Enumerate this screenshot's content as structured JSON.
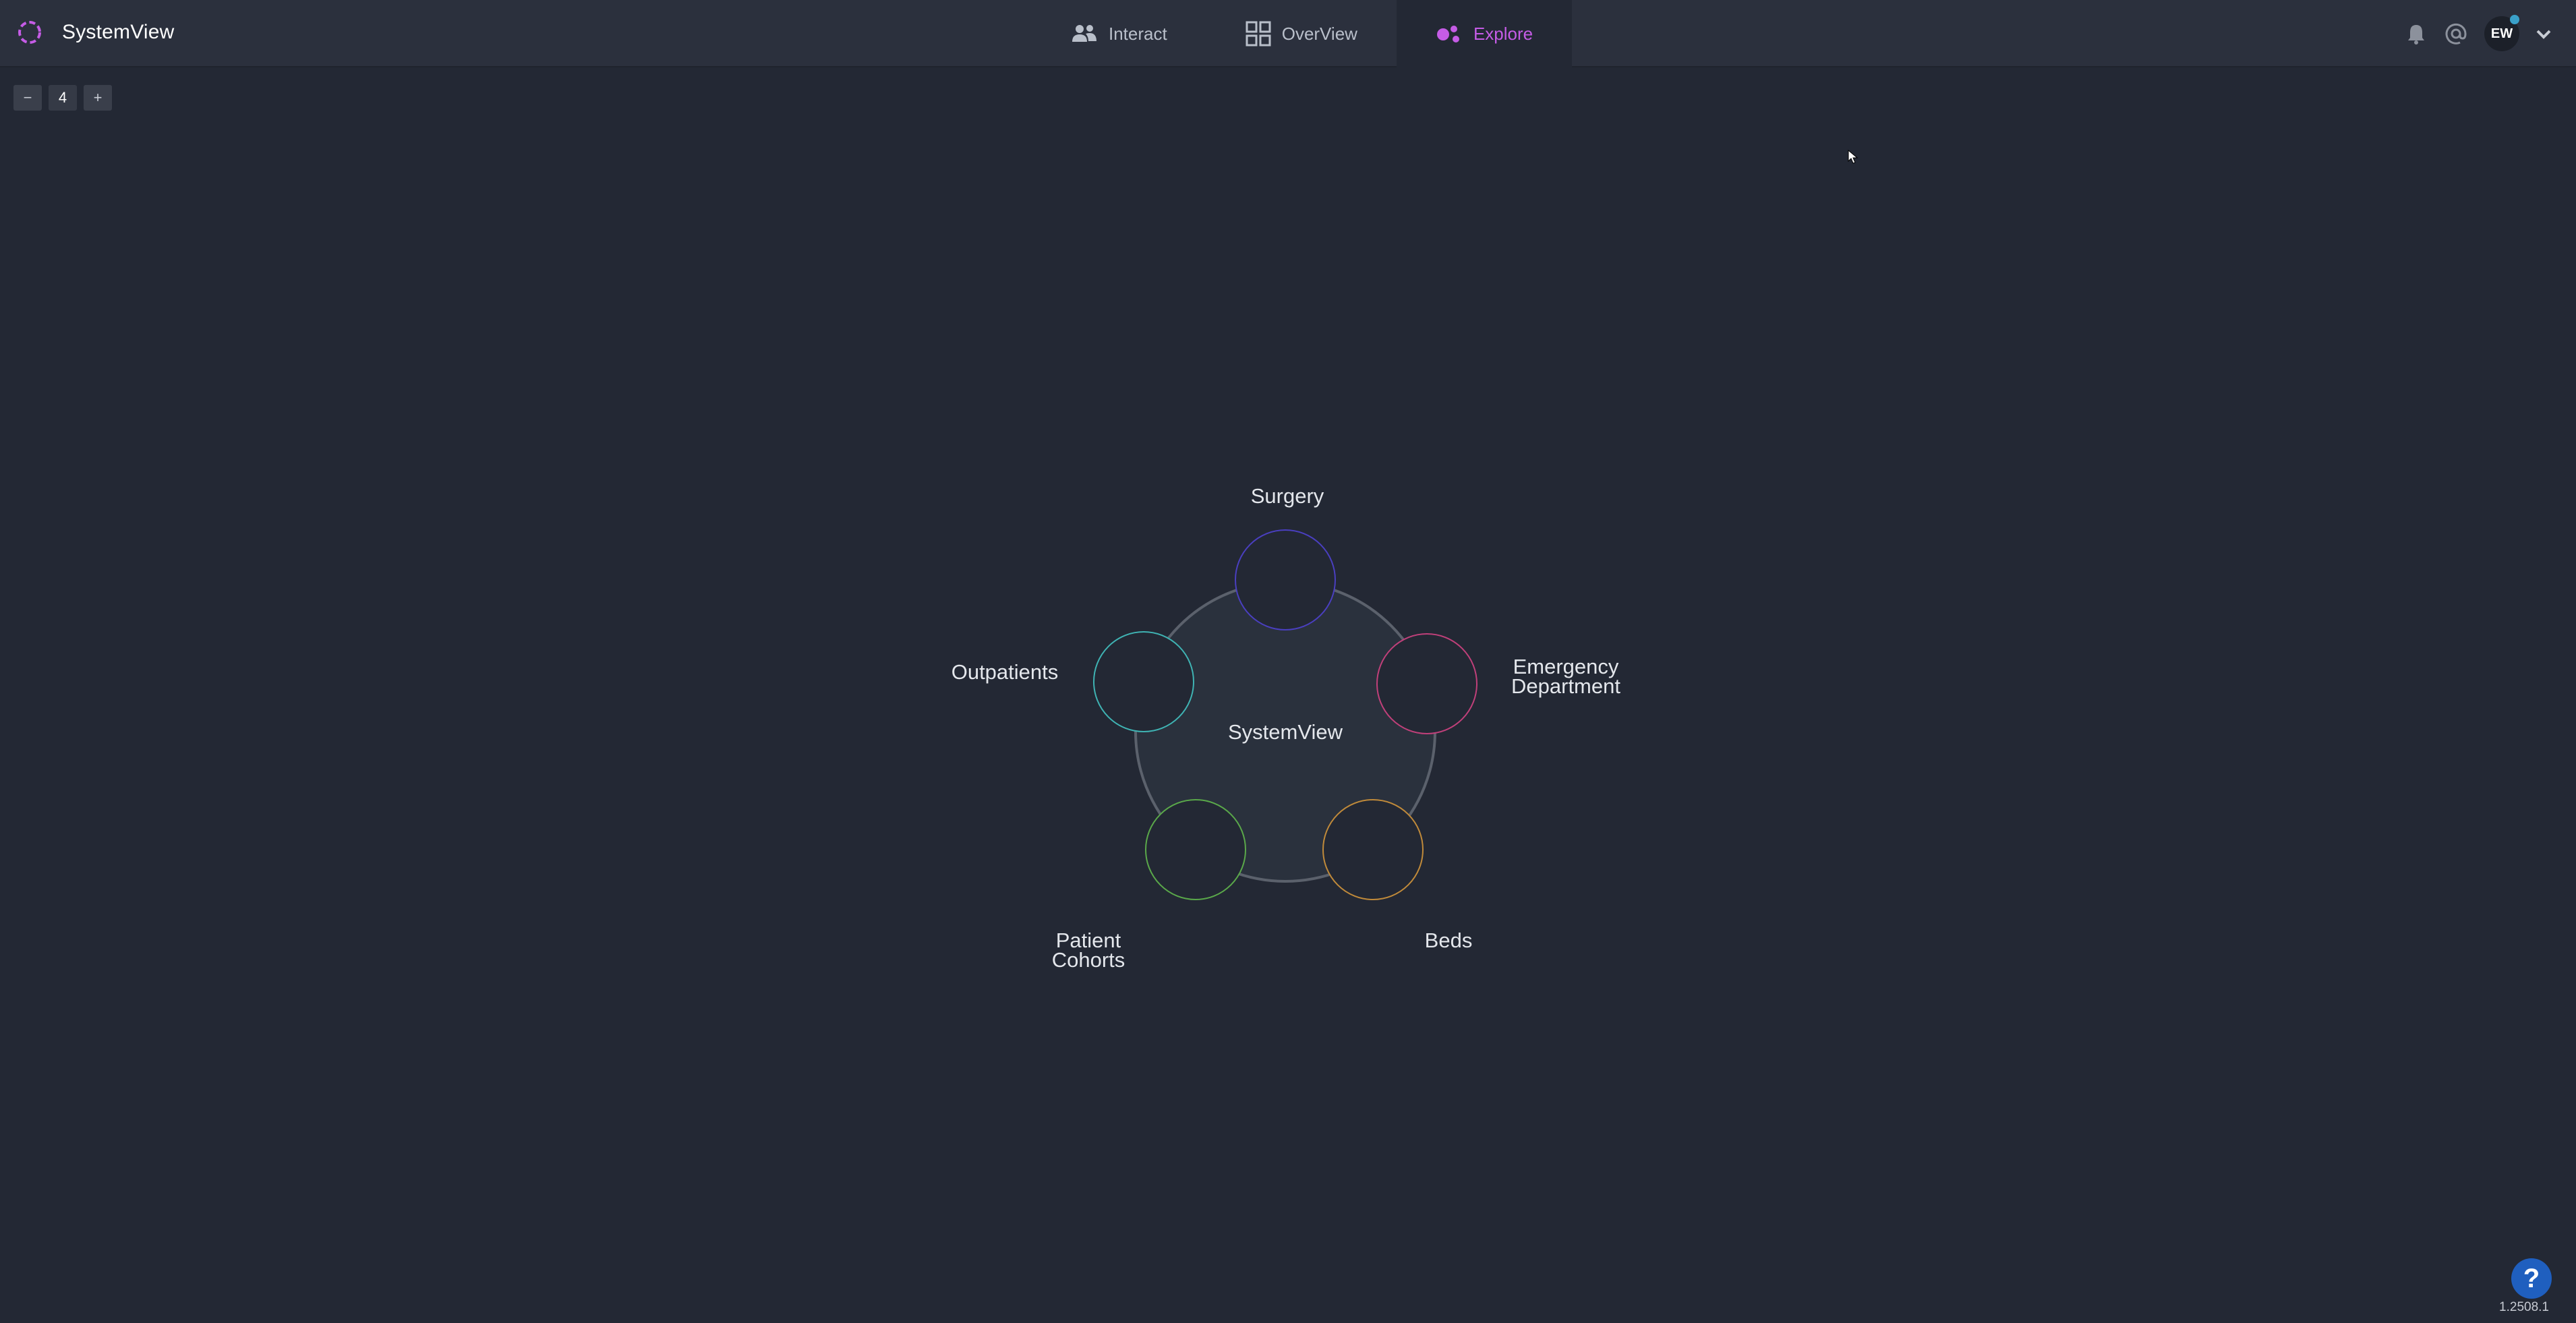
{
  "app": {
    "title": "SystemView",
    "accent": "#c55ce6"
  },
  "nav": {
    "items": [
      {
        "label": "Interact",
        "icon": "users-icon",
        "active": false
      },
      {
        "label": "OverView",
        "icon": "grid-icon",
        "active": false
      },
      {
        "label": "Explore",
        "icon": "explore-icon",
        "active": true
      }
    ]
  },
  "header": {
    "user_initials": "EW",
    "icons": [
      "bell-icon",
      "at-icon",
      "chevron-down-icon"
    ]
  },
  "zoom": {
    "minus_label": "−",
    "level": "4",
    "plus_label": "+"
  },
  "graph": {
    "center_label": "SystemView",
    "nodes": [
      {
        "name": "surgery",
        "line1": "Surgery",
        "line2": "",
        "color": "#4a3fc0"
      },
      {
        "name": "emergency-department",
        "line1": "Emergency",
        "line2": "Department",
        "color": "#c0407a"
      },
      {
        "name": "beds",
        "line1": "Beds",
        "line2": "",
        "color": "#c08a3a"
      },
      {
        "name": "patient-cohorts",
        "line1": "Patient",
        "line2": "Cohorts",
        "color": "#5aa84a"
      },
      {
        "name": "outpatients",
        "line1": "Outpatients",
        "line2": "",
        "color": "#3fb3b3"
      }
    ]
  },
  "footer": {
    "help_label": "?",
    "version": "1.2508.1"
  }
}
